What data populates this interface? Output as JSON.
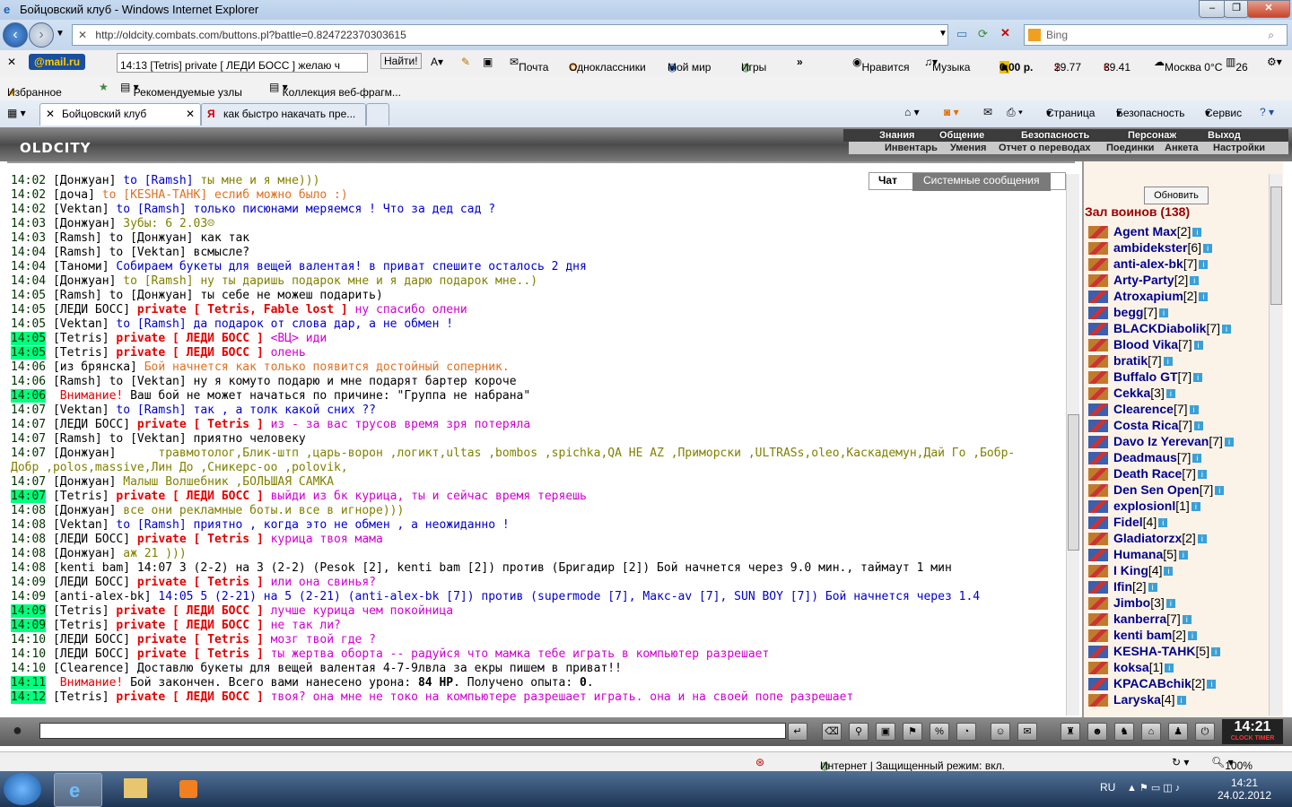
{
  "window": {
    "title": "Бойцовский клуб - Windows Internet Explorer"
  },
  "browser": {
    "address": "http://oldcity.combats.com/buttons.pl?battle=0.824722370303615",
    "search_placeholder": "Bing",
    "mail_logo": "@mail.ru",
    "mail_search_value": "14:13 [Tetris] private [ ЛЕДИ БОСС ] желаю ч",
    "find_button": "Найти!",
    "mail_links": [
      "Почта",
      "Одноклассники",
      "Мой мир",
      "Игры"
    ],
    "widgets": [
      "Нравится",
      "Музыка",
      "0,00 р.",
      "29.77",
      "39.41",
      "Москва 0°C",
      "26"
    ],
    "favorites": [
      "Избранное",
      "Рекомендуемые узлы",
      "Коллекция веб-фрагм..."
    ],
    "tabs": [
      "Бойцовский клуб",
      "как быстро накачать пре..."
    ],
    "cmd": [
      "Страница",
      "Безопасность",
      "Сервис"
    ]
  },
  "game": {
    "logo": "OLDCITY",
    "menu_top": [
      "Знания",
      "Общение",
      "Безопасность",
      "Персонаж",
      "Выход"
    ],
    "menu_bottom": [
      "Инвентарь",
      "Умения",
      "Отчет о переводах",
      "Поединки",
      "Анкета",
      "Настройки"
    ],
    "chat_tabs": [
      "Чат",
      "Системные сообщения"
    ],
    "refresh_button": "Обновить",
    "hall_title": "Зал воинов (138)",
    "clock": "14:21",
    "clock_label": "CLOCK TIMER"
  },
  "chat": [
    {
      "time": "14:02",
      "hl": false,
      "parts": [
        [
          "nick",
          "[Донжуан]"
        ],
        [
          "tc",
          " to [Ramsh]"
        ],
        [
          "olive",
          " ты мне и я мне)))"
        ]
      ]
    },
    {
      "time": "14:02",
      "hl": false,
      "parts": [
        [
          "nick",
          "[доча]"
        ],
        [
          "orange",
          " to [KESHA-ТАНК] еслиб можно было :)"
        ]
      ]
    },
    {
      "time": "14:02",
      "hl": false,
      "parts": [
        [
          "nick",
          "[Vektan]"
        ],
        [
          "blue",
          " to [Ramsh] только писюнами меряемся ! Что за дед сад ?"
        ]
      ]
    },
    {
      "time": "14:03",
      "hl": false,
      "parts": [
        [
          "nick",
          "[Донжуан]"
        ],
        [
          "olive",
          " Зубы: 6 2.03☹"
        ]
      ]
    },
    {
      "time": "14:03",
      "hl": false,
      "parts": [
        [
          "nick",
          "[Ramsh]"
        ],
        [
          "mtxt",
          " to [Донжуан] как так"
        ]
      ]
    },
    {
      "time": "14:04",
      "hl": false,
      "parts": [
        [
          "nick",
          "[Ramsh]"
        ],
        [
          "mtxt",
          " to [Vektan] всмысле?"
        ]
      ]
    },
    {
      "time": "14:04",
      "hl": false,
      "parts": [
        [
          "nick",
          "[Таноми]"
        ],
        [
          "blue",
          " Собираем букеты для вещей валентая! в приват спешите осталось 2 дня"
        ]
      ]
    },
    {
      "time": "14:04",
      "hl": false,
      "parts": [
        [
          "nick",
          "[Донжуан]"
        ],
        [
          "olive",
          " to [Ramsh] ну ты даришь подарок мне и я дарю подарок мне..)"
        ]
      ]
    },
    {
      "time": "14:05",
      "hl": false,
      "parts": [
        [
          "nick",
          "[Ramsh]"
        ],
        [
          "mtxt",
          " to [Донжуан] ты себе не можеш подарить)"
        ]
      ]
    },
    {
      "time": "14:05",
      "hl": false,
      "parts": [
        [
          "nick",
          "[ЛЕДИ БОСС]"
        ],
        [
          "ptag",
          " private [ Tetris, Fable lost ]"
        ],
        [
          "pmsg",
          " ну спасибо олени"
        ]
      ]
    },
    {
      "time": "14:05",
      "hl": false,
      "parts": [
        [
          "nick",
          "[Vektan]"
        ],
        [
          "blue",
          " to [Ramsh] да подарок от слова дар, а не обмен !"
        ]
      ]
    },
    {
      "time": "14:05",
      "hl": true,
      "parts": [
        [
          "nick",
          "[Tetris]"
        ],
        [
          "ptag",
          " private [ ЛЕДИ БОСС ]"
        ],
        [
          "pmsg",
          " <ВЦ> иди"
        ]
      ]
    },
    {
      "time": "14:05",
      "hl": true,
      "parts": [
        [
          "nick",
          "[Tetris]"
        ],
        [
          "ptag",
          " private [ ЛЕДИ БОСС ]"
        ],
        [
          "pmsg",
          " олень"
        ]
      ]
    },
    {
      "time": "14:06",
      "hl": false,
      "parts": [
        [
          "nick",
          "[из брянска]"
        ],
        [
          "orange",
          " Бой начнется как только появится достойный соперник."
        ]
      ]
    },
    {
      "time": "14:06",
      "hl": false,
      "parts": [
        [
          "nick",
          "[Ramsh]"
        ],
        [
          "mtxt",
          " to [Vektan] ну я комуто подарю и мне подарят бартер короче"
        ]
      ]
    },
    {
      "time": "14:06",
      "hl": true,
      "parts": [
        [
          "red",
          " Внимание!"
        ],
        [
          "mtxt",
          " Ваш бой не может начаться по причине: \"Группа не набрана\""
        ]
      ]
    },
    {
      "time": "14:07",
      "hl": false,
      "parts": [
        [
          "nick",
          "[Vektan]"
        ],
        [
          "blue",
          " to [Ramsh] так , а толк какой сних ??"
        ]
      ]
    },
    {
      "time": "14:07",
      "hl": false,
      "parts": [
        [
          "nick",
          "[ЛЕДИ БОСС]"
        ],
        [
          "ptag",
          " private [ Tetris ]"
        ],
        [
          "pmsg",
          " из - за вас трусов время зря потеряла"
        ]
      ]
    },
    {
      "time": "14:07",
      "hl": false,
      "parts": [
        [
          "nick",
          "[Ramsh]"
        ],
        [
          "mtxt",
          " to [Vektan] приятно человеку"
        ]
      ]
    },
    {
      "time": "14:07",
      "hl": false,
      "parts": [
        [
          "nick",
          "[Донжуан]"
        ],
        [
          "olive",
          "      травмотолог,Блик-штп ,царь-ворон ,логикт,ultas ,bombos ,spichka,QA HE AZ ,Приморски ,ULTRASs,oleo,Каскадемун,Дай Го ,Бобр-"
        ]
      ]
    },
    {
      "time": "",
      "hl": false,
      "parts": [
        [
          "olive",
          "Добр ,polos,massive,Лин До ,Сникерс-оо ,polovik,"
        ]
      ]
    },
    {
      "time": "14:07",
      "hl": false,
      "parts": [
        [
          "nick",
          "[Донжуан]"
        ],
        [
          "olive",
          " Малыш Волшебник ,БОЛЬШАЯ САМКА"
        ]
      ]
    },
    {
      "time": "14:07",
      "hl": true,
      "parts": [
        [
          "nick",
          "[Tetris]"
        ],
        [
          "ptag",
          " private [ ЛЕДИ БОСС ]"
        ],
        [
          "pmsg",
          " выйди из бк курица, ты и сейчас время теряешь"
        ]
      ]
    },
    {
      "time": "14:08",
      "hl": false,
      "parts": [
        [
          "nick",
          "[Донжуан]"
        ],
        [
          "olive",
          " все они рекламные боты.и все в игноре)))"
        ]
      ]
    },
    {
      "time": "14:08",
      "hl": false,
      "parts": [
        [
          "nick",
          "[Vektan]"
        ],
        [
          "blue",
          " to [Ramsh] приятно , когда это не обмен , а неожиданно !"
        ]
      ]
    },
    {
      "time": "14:08",
      "hl": false,
      "parts": [
        [
          "nick",
          "[ЛЕДИ БОСС]"
        ],
        [
          "ptag",
          " private [ Tetris ]"
        ],
        [
          "pmsg",
          " курица твоя мама"
        ]
      ]
    },
    {
      "time": "14:08",
      "hl": false,
      "parts": [
        [
          "nick",
          "[Донжуан]"
        ],
        [
          "olive",
          " аж 21 )))"
        ]
      ]
    },
    {
      "time": "14:08",
      "hl": false,
      "parts": [
        [
          "nick",
          "[kenti bam]"
        ],
        [
          "mtxt",
          " 14:07 3 (2-2) на 3 (2-2) (Pesok [2], kenti bam [2]) против (Бригадир [2]) Бой начнется через 9.0 мин., таймаут 1 мин"
        ]
      ]
    },
    {
      "time": "14:09",
      "hl": false,
      "parts": [
        [
          "nick",
          "[ЛЕДИ БОСС]"
        ],
        [
          "ptag",
          " private [ Tetris ]"
        ],
        [
          "pmsg",
          " или она свинья?"
        ]
      ]
    },
    {
      "time": "14:09",
      "hl": false,
      "parts": [
        [
          "nick",
          "[anti-alex-bk]"
        ],
        [
          "blue",
          " 14:05 5 (2-21) на 5 (2-21) (anti-alex-bk [7]) против (supermode [7], Макс-av [7], SUN BOY [7]) Бой начнется через 1.4"
        ]
      ]
    },
    {
      "time": "14:09",
      "hl": true,
      "parts": [
        [
          "nick",
          "[Tetris]"
        ],
        [
          "ptag",
          " private [ ЛЕДИ БОСС ]"
        ],
        [
          "pmsg",
          " лучше курица чем покойница"
        ]
      ]
    },
    {
      "time": "14:09",
      "hl": true,
      "parts": [
        [
          "nick",
          "[Tetris]"
        ],
        [
          "ptag",
          " private [ ЛЕДИ БОСС ]"
        ],
        [
          "pmsg",
          " не так ли?"
        ]
      ]
    },
    {
      "time": "14:10",
      "hl": false,
      "parts": [
        [
          "nick",
          "[ЛЕДИ БОСС]"
        ],
        [
          "ptag",
          " private [ Tetris ]"
        ],
        [
          "pmsg",
          " мозг твой где ?"
        ]
      ]
    },
    {
      "time": "14:10",
      "hl": false,
      "parts": [
        [
          "nick",
          "[ЛЕДИ БОСС]"
        ],
        [
          "ptag",
          " private [ Tetris ]"
        ],
        [
          "pmsg",
          " ты жертва оборта -- радуйся что мамка тебе играть в компьютер разрешает"
        ]
      ]
    },
    {
      "time": "14:10",
      "hl": false,
      "parts": [
        [
          "nick",
          "[Clearence]"
        ],
        [
          "mtxt",
          " Доставлю букеты для вещей валентая 4-7-9лвла за екры пишем в приват!!"
        ]
      ]
    },
    {
      "time": "14:11",
      "hl": true,
      "parts": [
        [
          "red",
          " Внимание!"
        ],
        [
          "mtxt",
          " Бой закончен. Всего вами нанесено урона: "
        ],
        [
          "nb",
          "84 HP"
        ],
        [
          "mtxt",
          ". Получено опыта: "
        ],
        [
          "nb",
          "0"
        ],
        [
          "mtxt",
          "."
        ]
      ]
    },
    {
      "time": "14:12",
      "hl": true,
      "parts": [
        [
          "nick",
          "[Tetris]"
        ],
        [
          "ptag",
          " private [ ЛЕДИ БОСС ]"
        ],
        [
          "pmsg",
          " твоя? она мне не токо на компьютере разрешает играть. она и на своей попе разрешает"
        ]
      ]
    }
  ],
  "players": [
    {
      "name": "Agent Max",
      "lvl": "[2]",
      "c": "#c07a2c"
    },
    {
      "name": "ambidekster",
      "lvl": "[6]",
      "c": "#c07a2c"
    },
    {
      "name": "anti-alex-bk",
      "lvl": "[7]",
      "c": "#c07a2c"
    },
    {
      "name": "Arty-Party",
      "lvl": "[2]",
      "c": "#c07a2c"
    },
    {
      "name": "Atroxapium",
      "lvl": "[2]",
      "c": "#3c5fae"
    },
    {
      "name": "begg",
      "lvl": "[7]",
      "c": "#3c5fae"
    },
    {
      "name": "BLACKDiabolik",
      "lvl": "[7]",
      "c": "#3c5fae"
    },
    {
      "name": "Blood Vika",
      "lvl": "[7]",
      "c": "#c07a2c"
    },
    {
      "name": "bratik",
      "lvl": "[7]",
      "c": "#c07a2c"
    },
    {
      "name": "Buffalo GT",
      "lvl": "[7]",
      "c": "#c07a2c"
    },
    {
      "name": "Cekka",
      "lvl": "[3]",
      "c": "#c07a2c"
    },
    {
      "name": "Clearence",
      "lvl": "[7]",
      "c": "#3c5fae"
    },
    {
      "name": "Costa Rica",
      "lvl": "[7]",
      "c": "#3c5fae"
    },
    {
      "name": "Davo Iz Yerevan",
      "lvl": "[7]",
      "c": "#3c5fae"
    },
    {
      "name": "Deadmaus",
      "lvl": "[7]",
      "c": "#3c5fae"
    },
    {
      "name": "Death Race",
      "lvl": "[7]",
      "c": "#c07a2c"
    },
    {
      "name": "Den Sen Open",
      "lvl": "[7]",
      "c": "#c07a2c"
    },
    {
      "name": "explosionl",
      "lvl": "[1]",
      "c": "#3c5fae"
    },
    {
      "name": "Fidel",
      "lvl": "[4]",
      "c": "#3c5fae"
    },
    {
      "name": "Gladiatorzx",
      "lvl": "[2]",
      "c": "#c07a2c"
    },
    {
      "name": "Humana",
      "lvl": "[5]",
      "c": "#3c5fae"
    },
    {
      "name": "I King",
      "lvl": "[4]",
      "c": "#c07a2c"
    },
    {
      "name": "Ifin",
      "lvl": "[2]",
      "c": "#3c5fae"
    },
    {
      "name": "Jimbo",
      "lvl": "[3]",
      "c": "#c07a2c"
    },
    {
      "name": "kanberra",
      "lvl": "[7]",
      "c": "#c07a2c"
    },
    {
      "name": "kenti bam",
      "lvl": "[2]",
      "c": "#c07a2c"
    },
    {
      "name": "KESHA-TAHK",
      "lvl": "[5]",
      "c": "#3c5fae"
    },
    {
      "name": "koksa",
      "lvl": "[1]",
      "c": "#c07a2c"
    },
    {
      "name": "KPACABchik",
      "lvl": "[2]",
      "c": "#3c5fae"
    },
    {
      "name": "Laryska",
      "lvl": "[4]",
      "c": "#c07a2c"
    }
  ],
  "status": {
    "zone": "Интернет | Защищенный режим: вкл.",
    "zoom": "100%"
  },
  "taskbar": {
    "lang": "RU",
    "time": "14:21",
    "date": "24.02.2012"
  }
}
